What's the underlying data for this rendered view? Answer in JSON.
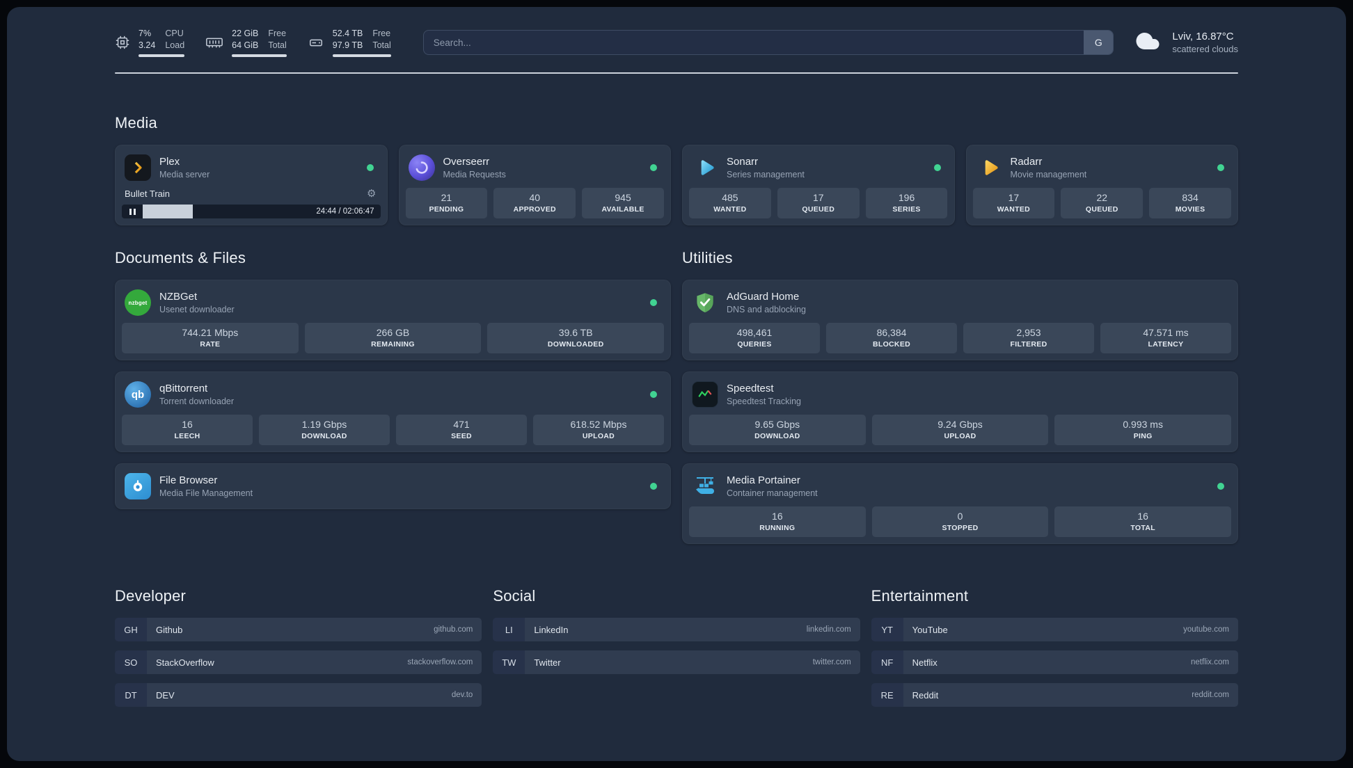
{
  "colors": {
    "status_online": "#41d392",
    "accent_plex": "#e5a00d",
    "background": "#202b3d",
    "card": "#2b3749"
  },
  "topbar": {
    "resources": [
      {
        "icon": "cpu-icon",
        "values": [
          "7%",
          "3.24"
        ],
        "labels": [
          "CPU",
          "Load"
        ]
      },
      {
        "icon": "memory-icon",
        "values": [
          "22 GiB",
          "64 GiB"
        ],
        "labels": [
          "Free",
          "Total"
        ]
      },
      {
        "icon": "disk-icon",
        "values": [
          "52.4 TB",
          "97.9 TB"
        ],
        "labels": [
          "Free",
          "Total"
        ]
      }
    ],
    "search": {
      "placeholder": "Search...",
      "provider_label": "G"
    },
    "weather": {
      "icon": "cloud-icon",
      "location": "Lviv, 16.87°C",
      "condition": "scattered clouds"
    }
  },
  "sections": {
    "media": "Media",
    "documents": "Documents & Files",
    "utilities": "Utilities",
    "developer": "Developer",
    "social": "Social",
    "entertainment": "Entertainment"
  },
  "services": {
    "plex": {
      "name": "Plex",
      "subtitle": "Media server",
      "icon": "plex-icon",
      "online": true,
      "player": {
        "title": "Bullet Train",
        "elapsed": "24:44",
        "duration": "02:06:47",
        "time_display": "24:44 / 02:06:47",
        "progress_percent": 19.5
      }
    },
    "overseerr": {
      "name": "Overseerr",
      "subtitle": "Media Requests",
      "icon": "overseerr-icon",
      "online": true,
      "stats": [
        {
          "value": "21",
          "label": "PENDING"
        },
        {
          "value": "40",
          "label": "APPROVED"
        },
        {
          "value": "945",
          "label": "AVAILABLE"
        }
      ]
    },
    "sonarr": {
      "name": "Sonarr",
      "subtitle": "Series management",
      "icon": "sonarr-icon",
      "online": true,
      "stats": [
        {
          "value": "485",
          "label": "WANTED"
        },
        {
          "value": "17",
          "label": "QUEUED"
        },
        {
          "value": "196",
          "label": "SERIES"
        }
      ]
    },
    "radarr": {
      "name": "Radarr",
      "subtitle": "Movie management",
      "icon": "radarr-icon",
      "online": true,
      "stats": [
        {
          "value": "17",
          "label": "WANTED"
        },
        {
          "value": "22",
          "label": "QUEUED"
        },
        {
          "value": "834",
          "label": "MOVIES"
        }
      ]
    },
    "nzbget": {
      "name": "NZBGet",
      "subtitle": "Usenet downloader",
      "icon": "nzbget-icon",
      "icon_text": "nzbget",
      "online": true,
      "stats": [
        {
          "value": "744.21 Mbps",
          "label": "RATE"
        },
        {
          "value": "266 GB",
          "label": "REMAINING"
        },
        {
          "value": "39.6 TB",
          "label": "DOWNLOADED"
        }
      ]
    },
    "qbittorrent": {
      "name": "qBittorrent",
      "subtitle": "Torrent downloader",
      "icon": "qbittorrent-icon",
      "icon_text": "qb",
      "online": true,
      "stats": [
        {
          "value": "16",
          "label": "LEECH"
        },
        {
          "value": "1.19 Gbps",
          "label": "DOWNLOAD"
        },
        {
          "value": "471",
          "label": "SEED"
        },
        {
          "value": "618.52 Mbps",
          "label": "UPLOAD"
        }
      ]
    },
    "filebrowser": {
      "name": "File Browser",
      "subtitle": "Media File Management",
      "icon": "filebrowser-icon",
      "online": true
    },
    "adguard": {
      "name": "AdGuard Home",
      "subtitle": "DNS and adblocking",
      "icon": "adguard-icon",
      "stats": [
        {
          "value": "498,461",
          "label": "QUERIES"
        },
        {
          "value": "86,384",
          "label": "BLOCKED"
        },
        {
          "value": "2,953",
          "label": "FILTERED"
        },
        {
          "value": "47.571 ms",
          "label": "LATENCY"
        }
      ]
    },
    "speedtest": {
      "name": "Speedtest",
      "subtitle": "Speedtest Tracking",
      "icon": "speedtest-icon",
      "stats": [
        {
          "value": "9.65 Gbps",
          "label": "DOWNLOAD"
        },
        {
          "value": "9.24 Gbps",
          "label": "UPLOAD"
        },
        {
          "value": "0.993 ms",
          "label": "PING"
        }
      ]
    },
    "portainer": {
      "name": "Media Portainer",
      "subtitle": "Container management",
      "icon": "portainer-icon",
      "online": true,
      "stats": [
        {
          "value": "16",
          "label": "RUNNING"
        },
        {
          "value": "0",
          "label": "STOPPED"
        },
        {
          "value": "16",
          "label": "TOTAL"
        }
      ]
    }
  },
  "bookmarks": {
    "developer": [
      {
        "abbr": "GH",
        "name": "Github",
        "domain": "github.com"
      },
      {
        "abbr": "SO",
        "name": "StackOverflow",
        "domain": "stackoverflow.com"
      },
      {
        "abbr": "DT",
        "name": "DEV",
        "domain": "dev.to"
      }
    ],
    "social": [
      {
        "abbr": "LI",
        "name": "LinkedIn",
        "domain": "linkedin.com"
      },
      {
        "abbr": "TW",
        "name": "Twitter",
        "domain": "twitter.com"
      }
    ],
    "entertainment": [
      {
        "abbr": "YT",
        "name": "YouTube",
        "domain": "youtube.com"
      },
      {
        "abbr": "NF",
        "name": "Netflix",
        "domain": "netflix.com"
      },
      {
        "abbr": "RE",
        "name": "Reddit",
        "domain": "reddit.com"
      }
    ]
  }
}
